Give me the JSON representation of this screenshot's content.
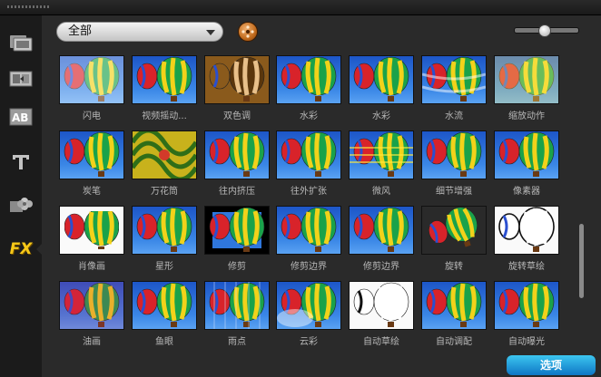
{
  "toolbar": {
    "category_value": "全部"
  },
  "sidebar": {
    "items": [
      {
        "icon": "media-filmstrip-icon"
      },
      {
        "icon": "transition-icon"
      },
      {
        "icon": "title-ab-icon"
      },
      {
        "icon": "text-t-icon"
      },
      {
        "icon": "graphics-flower-icon"
      },
      {
        "icon": "fx-icon",
        "label": "FX"
      }
    ]
  },
  "filters": [
    {
      "label": "闪电",
      "style": "flash"
    },
    {
      "label": "视频摇动...",
      "style": "normal"
    },
    {
      "label": "双色调",
      "style": "duotone"
    },
    {
      "label": "水彩",
      "style": "normal"
    },
    {
      "label": "水彩",
      "style": "normal"
    },
    {
      "label": "水流",
      "style": "water"
    },
    {
      "label": "缩放动作",
      "style": "zoom"
    },
    {
      "label": "炭笔",
      "style": "normal"
    },
    {
      "label": "万花筒",
      "style": "kaleido"
    },
    {
      "label": "往内挤压",
      "style": "normal"
    },
    {
      "label": "往外扩张",
      "style": "normal"
    },
    {
      "label": "微风",
      "style": "wind"
    },
    {
      "label": "细节增强",
      "style": "normal"
    },
    {
      "label": "像素器",
      "style": "normal"
    },
    {
      "label": "肖像画",
      "style": "portrait"
    },
    {
      "label": "星形",
      "style": "normal"
    },
    {
      "label": "修剪",
      "style": "crop"
    },
    {
      "label": "修剪边界",
      "style": "normal"
    },
    {
      "label": "修剪边界",
      "style": "normal"
    },
    {
      "label": "旋转",
      "style": "rotate"
    },
    {
      "label": "旋转草绘",
      "style": "sketch"
    },
    {
      "label": "油画",
      "style": "oil"
    },
    {
      "label": "鱼眼",
      "style": "normal"
    },
    {
      "label": "雨点",
      "style": "rain"
    },
    {
      "label": "云彩",
      "style": "cloud"
    },
    {
      "label": "自动草绘",
      "style": "lineart"
    },
    {
      "label": "自动调配",
      "style": "normal"
    },
    {
      "label": "自动曝光",
      "style": "normal"
    }
  ],
  "watermark": {
    "text": "选项"
  },
  "colors": {
    "panel": "#2a2a2a",
    "selection": "#3f7fd6",
    "caption": "#b8b8b8"
  }
}
